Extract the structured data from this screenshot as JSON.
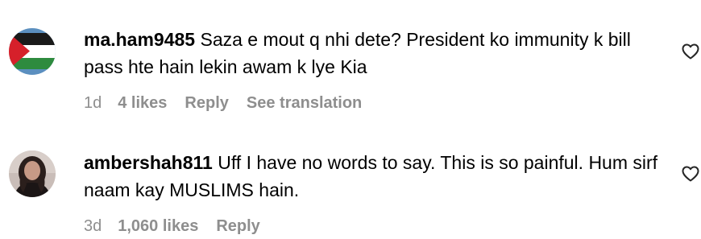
{
  "comments": [
    {
      "avatar_icon": "palestine-flag-avatar",
      "username": "ma.ham9485",
      "text": "Saza e mout q nhi dete? President ko immunity k bill pass hte hain lekin awam k lye Kia",
      "time": "1d",
      "likes": "4 likes",
      "reply_label": "Reply",
      "translate_label": "See translation",
      "like_icon": "heart-icon"
    },
    {
      "avatar_icon": "user-photo-avatar",
      "username": "ambershah811",
      "text": "Uff I have no words to say. This is so painful. Hum sirf naam kay MUSLIMS hain.",
      "time": "3d",
      "likes": "1,060 likes",
      "reply_label": "Reply",
      "like_icon": "heart-icon"
    }
  ],
  "colors": {
    "text": "#000000",
    "meta": "#8e8e8e"
  }
}
